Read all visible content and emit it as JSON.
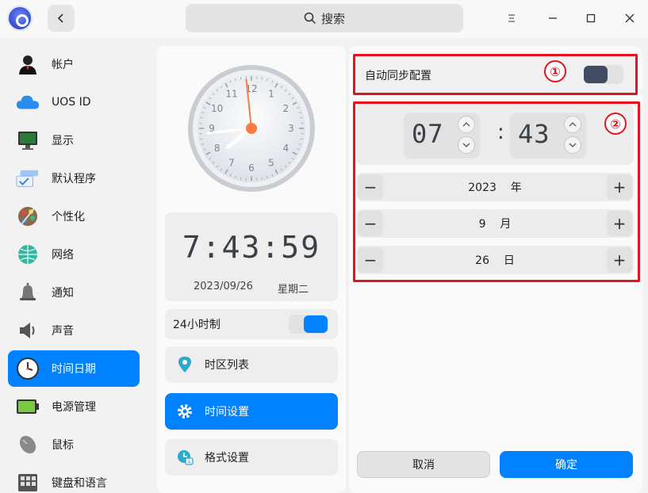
{
  "window": {
    "back_icon": "chevron-left-icon",
    "search_label": "搜索",
    "menu_icon": "menu-icon",
    "minimize_icon": "minimize-icon",
    "maximize_icon": "maximize-icon",
    "close_icon": "close-icon"
  },
  "sidebar": {
    "items": [
      {
        "label": "帐户",
        "icon": "account-icon"
      },
      {
        "label": "UOS ID",
        "icon": "cloud-icon"
      },
      {
        "label": "显示",
        "icon": "display-icon"
      },
      {
        "label": "默认程序",
        "icon": "default-apps-icon"
      },
      {
        "label": "个性化",
        "icon": "personalization-icon"
      },
      {
        "label": "网络",
        "icon": "network-icon"
      },
      {
        "label": "通知",
        "icon": "bell-icon"
      },
      {
        "label": "声音",
        "icon": "speaker-icon"
      },
      {
        "label": "时间日期",
        "icon": "clock-icon",
        "active": true
      },
      {
        "label": "电源管理",
        "icon": "battery-icon"
      },
      {
        "label": "鼠标",
        "icon": "mouse-icon"
      },
      {
        "label": "键盘和语言",
        "icon": "keyboard-icon"
      }
    ]
  },
  "left_panel": {
    "analog_clock": {
      "hour": 7,
      "minute": 43,
      "second": 59
    },
    "digital_time": "7:43:59",
    "date": "2023/09/26",
    "weekday": "星期二",
    "hour24_label": "24小时制",
    "hour24_enabled": true,
    "timezone_label": "时区列表",
    "time_settings_label": "时间设置",
    "format_settings_label": "格式设置"
  },
  "right_panel": {
    "auto_sync_label": "自动同步配置",
    "auto_sync_enabled": false,
    "marker_1": "①",
    "marker_2": "②",
    "hour": "07",
    "minute": "43",
    "colon": ":",
    "year_value": "2023",
    "year_unit": "年",
    "month_value": "9",
    "month_unit": "月",
    "day_value": "26",
    "day_unit": "日",
    "minus": "−",
    "plus": "+",
    "cancel_label": "取消",
    "ok_label": "确定"
  },
  "colors": {
    "accent": "#0081ff",
    "annotation": "#e3141e"
  }
}
